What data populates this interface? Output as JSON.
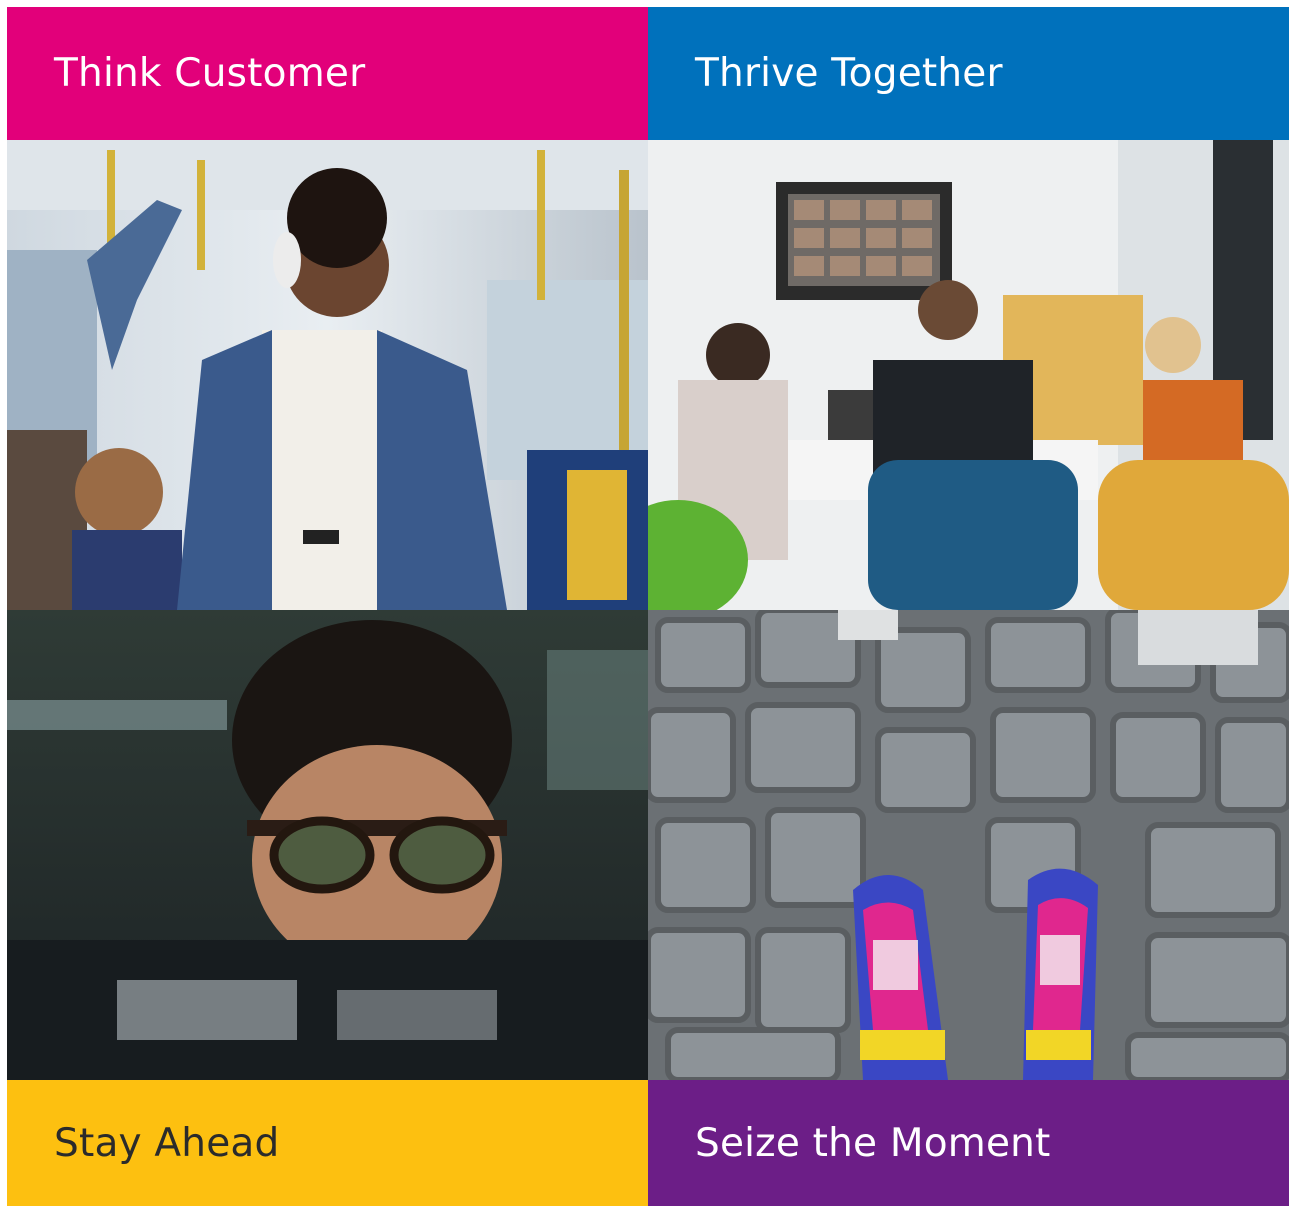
{
  "tiles": {
    "top_left": {
      "label": "Think Customer",
      "color": "#E2007A"
    },
    "top_right": {
      "label": "Thrive Together",
      "color": "#0071BC"
    },
    "bottom_left": {
      "label": "Stay Ahead",
      "color": "#FDC010"
    },
    "bottom_right": {
      "label": "Seize the Moment",
      "color": "#6C1E87"
    }
  },
  "photos": {
    "bus": {
      "subject": "man-with-headphones-on-bus"
    },
    "meeting": {
      "subject": "team-video-conference-meeting"
    },
    "screen": {
      "subject": "woman-with-glasses-at-screen"
    },
    "sneakers": {
      "subject": "sneakers-on-cobblestones"
    }
  }
}
